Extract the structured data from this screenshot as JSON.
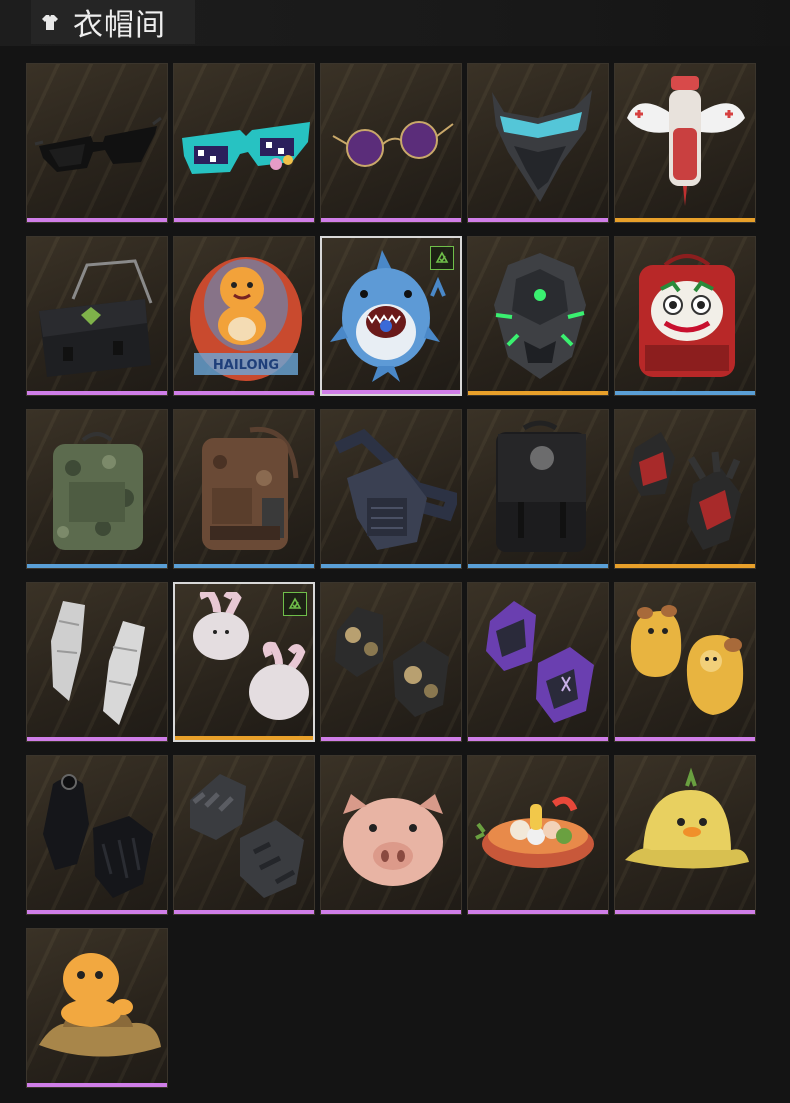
{
  "header": {
    "title": "衣帽间",
    "icon": "wardrobe-icon"
  },
  "items": [
    {
      "name": "black-sunglasses",
      "rarity": "purple",
      "selected": false,
      "badge": false
    },
    {
      "name": "pixel-sunglasses",
      "rarity": "purple",
      "selected": false,
      "badge": false
    },
    {
      "name": "round-purple-glasses",
      "rarity": "purple",
      "selected": false,
      "badge": false
    },
    {
      "name": "cyber-visor-mask",
      "rarity": "purple",
      "selected": false,
      "badge": false
    },
    {
      "name": "nurse-syringe-pack",
      "rarity": "orange",
      "selected": false,
      "badge": false
    },
    {
      "name": "black-messenger-bag",
      "rarity": "purple",
      "selected": false,
      "badge": false
    },
    {
      "name": "dinosaur-capsule-backpack",
      "rarity": "purple",
      "selected": false,
      "badge": false
    },
    {
      "name": "shark-backpack",
      "rarity": "purple",
      "selected": true,
      "badge": true
    },
    {
      "name": "cyber-armor-pack",
      "rarity": "orange",
      "selected": false,
      "badge": false
    },
    {
      "name": "lion-dance-backpack",
      "rarity": "blue",
      "selected": false,
      "badge": false
    },
    {
      "name": "camo-backpack",
      "rarity": "blue",
      "selected": false,
      "badge": false
    },
    {
      "name": "brown-tactical-backpack",
      "rarity": "blue",
      "selected": false,
      "badge": false
    },
    {
      "name": "navy-sling-bag",
      "rarity": "blue",
      "selected": false,
      "badge": false
    },
    {
      "name": "black-leather-backpack",
      "rarity": "blue",
      "selected": false,
      "badge": false
    },
    {
      "name": "red-tactical-gloves",
      "rarity": "orange",
      "selected": false,
      "badge": false
    },
    {
      "name": "silver-sequin-gloves",
      "rarity": "purple",
      "selected": false,
      "badge": false
    },
    {
      "name": "bunny-plush-gloves",
      "rarity": "orange",
      "selected": true,
      "badge": true
    },
    {
      "name": "gold-camo-gloves",
      "rarity": "purple",
      "selected": false,
      "badge": false
    },
    {
      "name": "purple-gloves",
      "rarity": "purple",
      "selected": false,
      "badge": false
    },
    {
      "name": "yellow-dog-mittens",
      "rarity": "purple",
      "selected": false,
      "badge": false
    },
    {
      "name": "black-leather-gloves",
      "rarity": "purple",
      "selected": false,
      "badge": false
    },
    {
      "name": "gray-knuckle-gloves",
      "rarity": "purple",
      "selected": false,
      "badge": false
    },
    {
      "name": "pig-mask",
      "rarity": "purple",
      "selected": false,
      "badge": false
    },
    {
      "name": "food-bowl-hat",
      "rarity": "purple",
      "selected": false,
      "badge": false
    },
    {
      "name": "duck-bucket-hat",
      "rarity": "purple",
      "selected": false,
      "badge": false
    },
    {
      "name": "dinosaur-bucket-hat",
      "rarity": "purple",
      "selected": false,
      "badge": false
    }
  ]
}
